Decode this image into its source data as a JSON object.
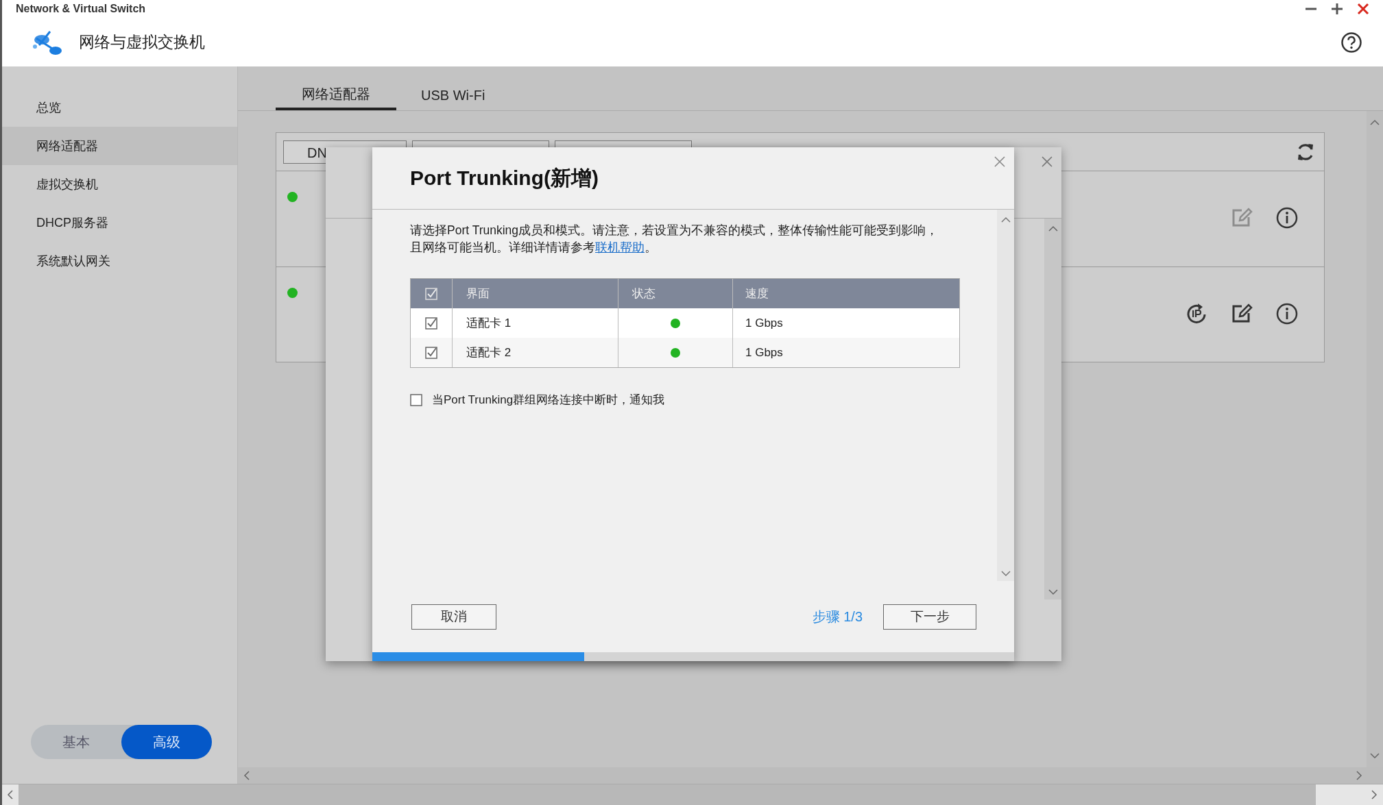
{
  "window": {
    "title": "Network & Virtual Switch"
  },
  "header": {
    "title": "网络与虚拟交换机"
  },
  "sidebar": {
    "items": [
      {
        "label": "总览",
        "selected": false
      },
      {
        "label": "网络适配器",
        "selected": true
      },
      {
        "label": "虚拟交换机",
        "selected": false
      },
      {
        "label": "DHCP服务器",
        "selected": false
      },
      {
        "label": "系统默认网关",
        "selected": false
      }
    ],
    "mode_toggle": [
      {
        "label": "基本",
        "selected": false
      },
      {
        "label": "高级",
        "selected": true
      }
    ]
  },
  "tabs": [
    {
      "label": "网络适配器",
      "selected": true
    },
    {
      "label": "USB Wi-Fi",
      "selected": false
    }
  ],
  "panel": {
    "toolbar_buttons": [
      {
        "kind": "labeled",
        "label": "DN"
      },
      {
        "kind": "blank"
      },
      {
        "kind": "blank"
      }
    ],
    "adapters": [
      {
        "color": "#22b322",
        "actions": [
          {
            "kind": "edit",
            "disabled": true
          },
          {
            "kind": "info",
            "disabled": false
          }
        ]
      },
      {
        "color": "#22b322",
        "actions": [
          {
            "kind": "ip",
            "disabled": false
          },
          {
            "kind": "edit",
            "disabled": false
          },
          {
            "kind": "info",
            "disabled": false
          }
        ]
      }
    ]
  },
  "dialog": {
    "title": "Port Trunking(新增)",
    "description": {
      "text": "请选择Port Trunking成员和模式。请注意，若设置为不兼容的模式，整体传输性能可能受到影响，且网络可能当机。详细详情请参考",
      "link": "联机帮助",
      "after": "。"
    },
    "table": {
      "all_checked": true,
      "columns": [
        "界面",
        "状态",
        "速度"
      ],
      "rows": [
        {
          "checked": true,
          "interface": "适配卡 1",
          "color": "#22b322",
          "speed": "1 Gbps"
        },
        {
          "checked": true,
          "interface": "适配卡 2",
          "color": "#22b322",
          "speed": "1 Gbps"
        }
      ]
    },
    "notify": {
      "label": "当Port Trunking群组网络连接中断时，通知我",
      "checked": false
    },
    "cancel": "取消",
    "step": "步骤 1/3",
    "next": "下一步",
    "progress": {
      "level": 0.33
    }
  }
}
